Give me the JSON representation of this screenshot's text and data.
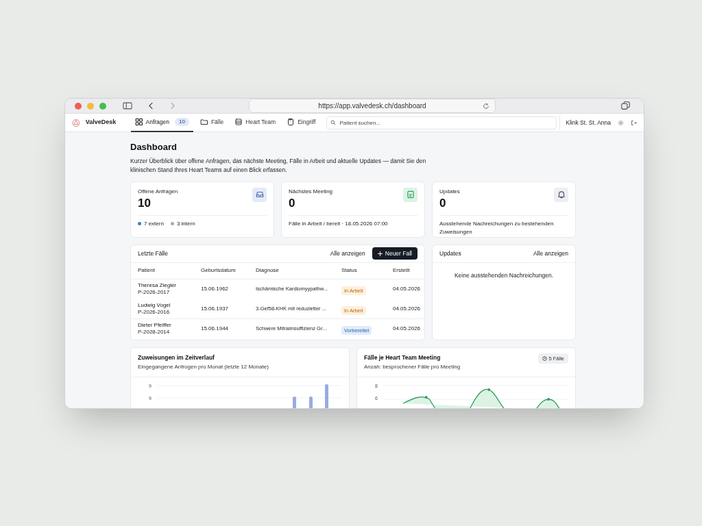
{
  "browser": {
    "url": "https://app.valvedesk.ch/dashboard"
  },
  "app": {
    "name": "ValveDesk",
    "tabs": [
      {
        "label": "Anfragen",
        "count": "10",
        "kind": "grid",
        "selected": true
      },
      {
        "label": "Fälle",
        "kind": "folder",
        "selected": false
      },
      {
        "label": "Heart Team",
        "kind": "list",
        "selected": false
      },
      {
        "label": "Eingriff",
        "kind": "clipboard",
        "selected": false
      }
    ],
    "search": {
      "placeholder": "Patient suchen..."
    },
    "clinic": "Klink St. St. Anna"
  },
  "page": {
    "title": "Dashboard",
    "intro": "Kurzer Überblick über offene Anfragen, das nächste Meeting, Fälle in Arbeit und aktuelle Updates — damit Sie den klinischen Stand Ihres Heart Teams auf einen Blick erfassen."
  },
  "stats": [
    {
      "label": "Offene Anfragen",
      "value": "10",
      "kind": "inbox",
      "color": "#4f6fb8",
      "legend": [
        {
          "text": "7 extern",
          "color": "#3b82c4"
        },
        {
          "text": "3 intern",
          "color": "#a3acbd"
        }
      ]
    },
    {
      "label": "Nächstes Meeting",
      "value": "0",
      "kind": "calendar",
      "color": "#2f9e5f",
      "note": "Fälle in Arbeit / bereit · 18.05.2026 07:00"
    },
    {
      "label": "Updates",
      "value": "0",
      "kind": "bell",
      "color": "#4b5563",
      "note": "Ausstehende Nachreichungen zu bestehenden Zuweisungen"
    }
  ],
  "cases": {
    "title": "Letzte Fälle",
    "link": "Alle anzeigen",
    "button": "Neuer Fall",
    "columns": [
      "Patient",
      "Geburtsdatum",
      "Diagnose",
      "Status",
      "Erstellt"
    ],
    "rows": [
      {
        "name": "Theresa Ziegler",
        "id": "P-2026-2017",
        "birth": "15.06.1962",
        "diagnosis": "Ischämische Kardiomyypathw...",
        "status": "In Arbeit",
        "kind": "progress",
        "created": "04.05.2026"
      },
      {
        "name": "Ludwig Vogel",
        "id": "P-2026-2016",
        "birth": "15.06.1937",
        "diagnosis": "3-Gef58-KHK mit reduzietter ...",
        "status": "In Arbeit",
        "kind": "progress",
        "created": "04.05.2026"
      },
      {
        "name": "Dieter Pfeiffer",
        "id": "P-2028-2014",
        "birth": "15.06.1944",
        "diagnosis": "Schwere Mitraimsuffizienz Gr...",
        "status": "Vorbereitet",
        "kind": "prepared",
        "created": "04.05.2026"
      }
    ]
  },
  "updates": {
    "title": "Updates",
    "link": "Alle anzeigen",
    "empty": "Keine ausstehenden Nachreichungen."
  },
  "charts": [
    {
      "kind": "bar",
      "title": "Zuweisungen im Zeitverlauf",
      "subtitle": "Eingegangene Anfrogen pro Monat (letzte 12 Monate)",
      "ticks": [
        "9",
        "9"
      ]
    },
    {
      "kind": "line",
      "title": "Fälle je Heart Team Meeting",
      "subtitle": "Anzah: besprochener Fälle pro Meeting",
      "badge": "5 Fälle",
      "ticks": [
        "8",
        "6"
      ]
    }
  ]
}
